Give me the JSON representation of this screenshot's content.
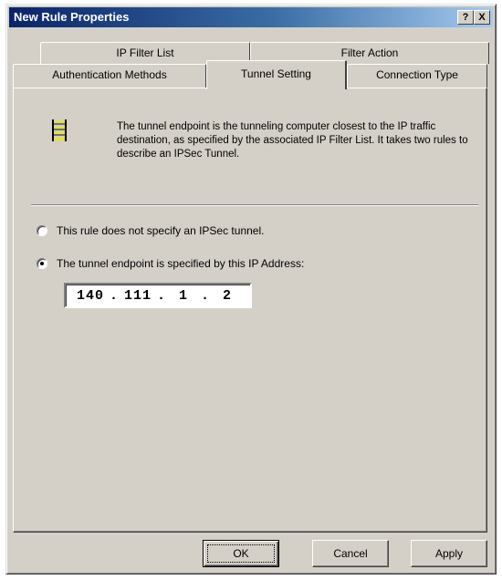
{
  "window": {
    "title": "New Rule Properties",
    "help_label": "?",
    "close_label": "X"
  },
  "tabs": {
    "row1": [
      "IP Filter List",
      "Filter Action"
    ],
    "row2": [
      "Authentication Methods",
      "Tunnel Setting",
      "Connection Type"
    ],
    "active": "Tunnel Setting"
  },
  "panel": {
    "icon": "tunnel-endpoint-icon",
    "description": "The tunnel endpoint is the tunneling computer closest to the IP traffic destination, as specified by the associated IP Filter List. It takes two rules to describe an IPSec Tunnel.",
    "option_no_tunnel": "This rule does not specify an IPSec tunnel.",
    "option_tunnel_ip": "The tunnel endpoint is specified by this IP Address:",
    "selected_option": "tunnel_ip",
    "ip_address": [
      "140",
      "111",
      "1",
      "2"
    ]
  },
  "buttons": {
    "ok": "OK",
    "cancel": "Cancel",
    "apply": "Apply"
  },
  "colors": {
    "title_bar_start": "#0a246a",
    "title_bar_end": "#a6caf0",
    "dialog_face": "#d4d0c8"
  }
}
